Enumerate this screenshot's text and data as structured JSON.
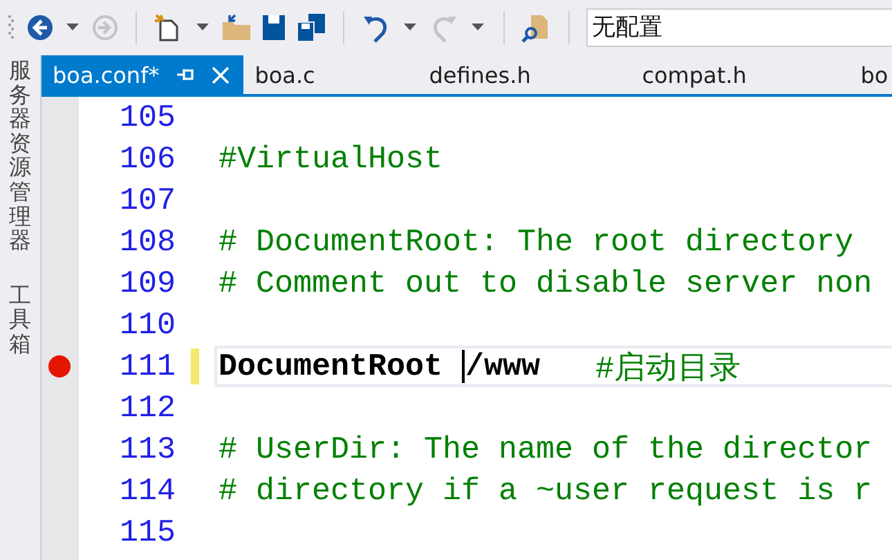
{
  "toolbar": {
    "back_disabled": false,
    "forward_disabled": true,
    "undo_disabled": false,
    "redo_disabled": true,
    "configuration": "无配置"
  },
  "side_panels": [
    "服务器资源管理器",
    "工具箱"
  ],
  "tabs": [
    {
      "label": "boa.conf*",
      "selected": true
    },
    {
      "label": "boa.c",
      "selected": false
    },
    {
      "label": "defines.h",
      "selected": false
    },
    {
      "label": "compat.h",
      "selected": false
    },
    {
      "label": "bo",
      "selected": false
    }
  ],
  "lines": [
    {
      "number": "105",
      "breakpoint": false,
      "modified": false,
      "current": false
    },
    {
      "number": "106",
      "breakpoint": false,
      "modified": false,
      "current": false,
      "segments": [
        {
          "kind": "comment",
          "text": "#VirtualHost"
        }
      ]
    },
    {
      "number": "107",
      "breakpoint": false,
      "modified": false,
      "current": false
    },
    {
      "number": "108",
      "breakpoint": false,
      "modified": false,
      "current": false,
      "segments": [
        {
          "kind": "comment",
          "text": "# DocumentRoot: The root directory"
        }
      ]
    },
    {
      "number": "109",
      "breakpoint": false,
      "modified": false,
      "current": false,
      "segments": [
        {
          "kind": "comment",
          "text": "# Comment out to disable server non"
        }
      ]
    },
    {
      "number": "110",
      "breakpoint": false,
      "modified": false,
      "current": false
    },
    {
      "number": "111",
      "breakpoint": true,
      "modified": true,
      "current": true,
      "segments": [
        {
          "kind": "directive",
          "text": "DocumentRoot",
          "caret": false
        },
        {
          "kind": "directive",
          "text": "/www",
          "caret": true
        },
        {
          "kind": "comment",
          "text": "#启动目录"
        }
      ]
    },
    {
      "number": "112",
      "breakpoint": false,
      "modified": false,
      "current": false
    },
    {
      "number": "113",
      "breakpoint": false,
      "modified": false,
      "current": false,
      "segments": [
        {
          "kind": "comment",
          "text": "# UserDir: The name of the director"
        }
      ]
    },
    {
      "number": "114",
      "breakpoint": false,
      "modified": false,
      "current": false,
      "segments": [
        {
          "kind": "comment",
          "text": "# directory if a ~user request is r"
        }
      ]
    },
    {
      "number": "115",
      "breakpoint": false,
      "modified": false,
      "current": false
    }
  ]
}
